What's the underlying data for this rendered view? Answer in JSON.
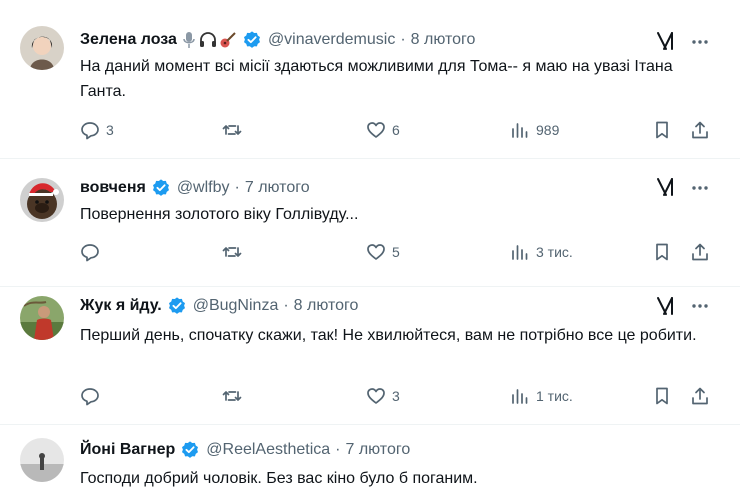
{
  "tweets": [
    {
      "name": "Зелена лоза",
      "badges": [
        "microphone-icon",
        "headphones-icon",
        "guitar-icon"
      ],
      "handle": "@vinaverdemusic",
      "dot": "·",
      "date": "8 лютого",
      "text": "На даний момент всі місії здаються можливими для Тома-- я маю на увазі Ітана Ганта.",
      "replies": "3",
      "retweets": "",
      "likes": "6",
      "views": "989"
    },
    {
      "name": "вовченя",
      "badges": [],
      "handle": "@wlfby",
      "dot": "·",
      "date": "7 лютого",
      "text": "Повернення золотого віку Голлівуду...",
      "replies": "",
      "retweets": "",
      "likes": "5",
      "views": "3 тис."
    },
    {
      "name": "Жук я йду.",
      "badges": [],
      "handle": "@BugNinza",
      "dot": "·",
      "date": "8 лютого",
      "text": "Перший день, спочатку скажи, так! Не хвилюйтеся, вам не потрібно все це робити.",
      "replies": "",
      "retweets": "",
      "likes": "3",
      "views": "1 тис."
    },
    {
      "name": "Йоні Вагнер",
      "badges": [],
      "handle": "@ReelAesthetica",
      "dot": "·",
      "date": "7 лютого",
      "text": "Господи добрий чоловік. Без вас кіно було б поганим."
    }
  ],
  "colors": {
    "verified": "#1d9bf0",
    "muted": "#536471",
    "text": "#0f1419",
    "divider": "#eff3f4"
  }
}
